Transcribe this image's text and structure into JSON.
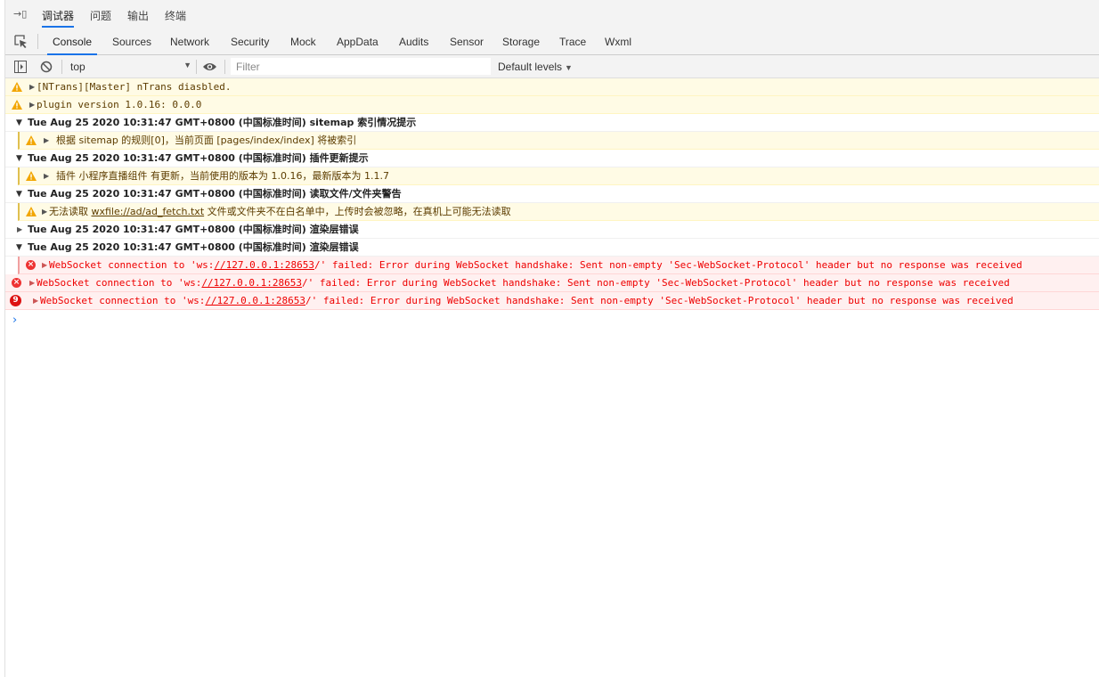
{
  "top_tabs": [
    {
      "label": "调试器",
      "active": true
    },
    {
      "label": "问题",
      "active": false
    },
    {
      "label": "输出",
      "active": false
    },
    {
      "label": "终端",
      "active": false
    }
  ],
  "panel_tabs": [
    "Console",
    "Sources",
    "Network",
    "Security",
    "Mock",
    "AppData",
    "Audits",
    "Sensor",
    "Storage",
    "Trace",
    "Wxml"
  ],
  "toolbar": {
    "context": "top",
    "filter_placeholder": "Filter",
    "levels": "Default levels"
  },
  "log": {
    "w1": "[NTrans][Master] nTrans diasbled.",
    "w2": "plugin version 1.0.16: 0.0.0",
    "g1": "Tue Aug 25 2020 10:31:47 GMT+0800 (中国标准时间) sitemap 索引情况提示",
    "g1_child": "根据 sitemap 的规则[0]，当前页面 [pages/index/index] 将被索引",
    "g2": "Tue Aug 25 2020 10:31:47 GMT+0800 (中国标准时间) 插件更新提示",
    "g2_child": "插件 小程序直播组件 有更新，当前使用的版本为 1.0.16，最新版本为 1.1.7",
    "g3": "Tue Aug 25 2020 10:31:47 GMT+0800 (中国标准时间) 读取文件/文件夹警告",
    "g3_child_a": "无法读取 ",
    "g3_child_link": "wxfile://ad/ad_fetch.txt",
    "g3_child_b": " 文件或文件夹不在白名单中，上传时会被忽略，在真机上可能无法读取",
    "g4": "Tue Aug 25 2020 10:31:47 GMT+0800 (中国标准时间) 渲染层错误",
    "g5": "Tue Aug 25 2020 10:31:47 GMT+0800 (中国标准时间) 渲染层错误",
    "ws_pre": "WebSocket connection to 'ws:",
    "ws_link": "//127.0.0.1:28653",
    "ws_post": "/' failed: Error during WebSocket handshake: Sent non-empty 'Sec-WebSocket-Protocol' header but no response was received",
    "error_count": "9"
  },
  "colors": {
    "accent": "#1a73e8",
    "warn_bg": "#fffbe5",
    "err_bg": "#fff0f0",
    "err_text": "#ee0000"
  }
}
